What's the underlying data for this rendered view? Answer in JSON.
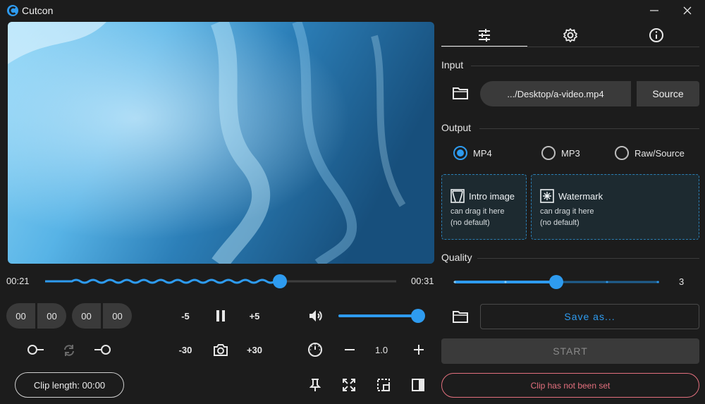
{
  "app": {
    "title": "Cutcon"
  },
  "colors": {
    "accent": "#2e9bef",
    "error": "#e3707e",
    "background": "#1c1c1c"
  },
  "player": {
    "current_time": "00:21",
    "end_time": "00:31",
    "progress": 0.67,
    "volume": 1.0
  },
  "timecodes": {
    "start": [
      "00",
      "00"
    ],
    "end": [
      "00",
      "00"
    ]
  },
  "controls": {
    "back5": "-5",
    "fwd5": "+5",
    "back30": "-30",
    "fwd30": "+30",
    "speed": "1.0"
  },
  "clip": {
    "length_label": "Clip length:  00:00"
  },
  "panel": {
    "tabs": [
      "settings-sliders-icon",
      "gear-icon",
      "info-icon"
    ],
    "active_tab": 0,
    "input": {
      "label": "Input",
      "path": ".../Desktop/a-video.mp4",
      "source_button": "Source"
    },
    "output": {
      "label": "Output",
      "formats": [
        "MP4",
        "MP3",
        "Raw/Source"
      ],
      "selected": "MP4",
      "intro": {
        "title": "Intro image",
        "hint": "can drag it here",
        "default": "(no default)"
      },
      "watermark": {
        "title": "Watermark",
        "hint": "can drag it here",
        "default": "(no default)"
      }
    },
    "quality": {
      "label": "Quality",
      "value": "3",
      "level_fraction": 0.5
    },
    "save_as": "Save as...",
    "start": "START",
    "status": "Clip has not been set"
  }
}
